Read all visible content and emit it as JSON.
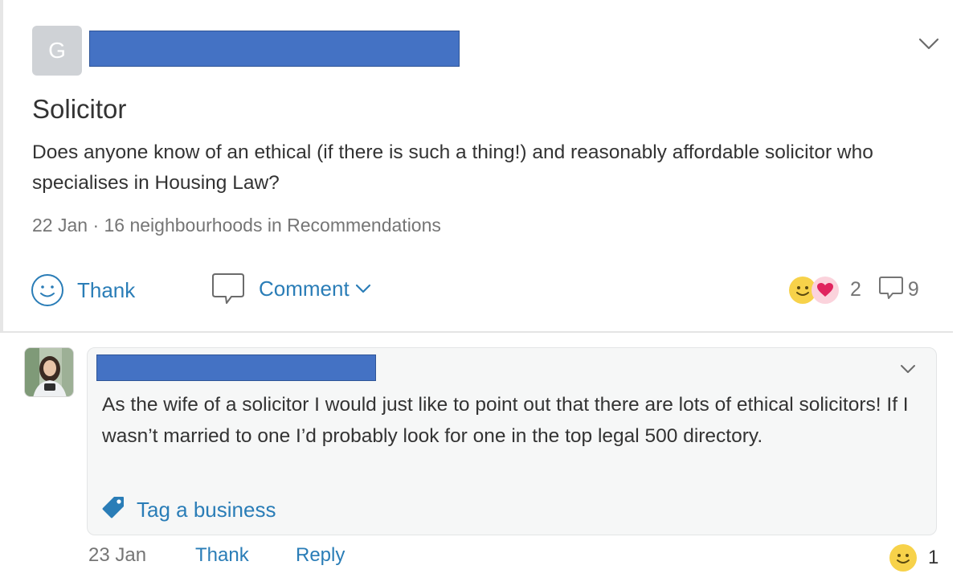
{
  "post": {
    "author_initial": "G",
    "title": "Solicitor",
    "body": "Does anyone know of an ethical (if there is such a thing!) and reasonably affordable solicitor who specialises in Housing Law?",
    "meta": "22 Jan · 16 neighbourhoods in Recommendations",
    "actions": {
      "thank_label": "Thank",
      "comment_label": "Comment"
    },
    "reaction_count": "2",
    "comment_count": "9"
  },
  "comment": {
    "text": "As the wife of a solicitor I would just like to point out that there are lots of ethical solicitors! If I wasn’t married to one I’d probably look for one in the top legal 500 directory.",
    "tag_business_label": "Tag a business",
    "date": "23 Jan",
    "thank_label": "Thank",
    "reply_label": "Reply",
    "reaction_count": "1"
  },
  "colors": {
    "link_blue": "#2a7db7",
    "redaction_blue": "#4472c4",
    "emoji_yellow": "#f7d24a",
    "heart_red": "#e0245e",
    "meta_gray": "#757575"
  },
  "icons": {
    "post_menu": "chevron-down-icon",
    "thank": "smiley-icon",
    "comment": "speech-bubble-icon",
    "tag": "tag-icon",
    "heart": "heart-icon"
  }
}
